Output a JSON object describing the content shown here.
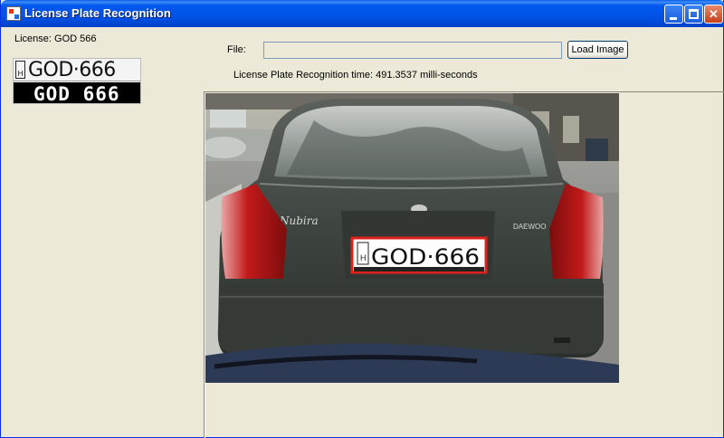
{
  "window": {
    "title": "License Plate Recognition"
  },
  "license": {
    "label": "License: GOD 566"
  },
  "plate_thumbnail": {
    "top_country": "H",
    "top_text": "GOD·666",
    "bottom_text": "GOD 666"
  },
  "file": {
    "label": "File:",
    "value": "",
    "load_button": "Load Image"
  },
  "recognition": {
    "time_text": "License Plate Recognition time: 491.3537 milli-seconds"
  },
  "photo": {
    "car_badge_model": "Nubira",
    "car_badge_brand": "DAEWOO",
    "plate_country": "H",
    "plate_text": "GOD·666",
    "plate_dealer_left": "",
    "plate_dealer_right": ""
  },
  "colors": {
    "titlebar": "#0053E6",
    "window_bg": "#ECE9D8",
    "plate_highlight": "#E0201A"
  }
}
